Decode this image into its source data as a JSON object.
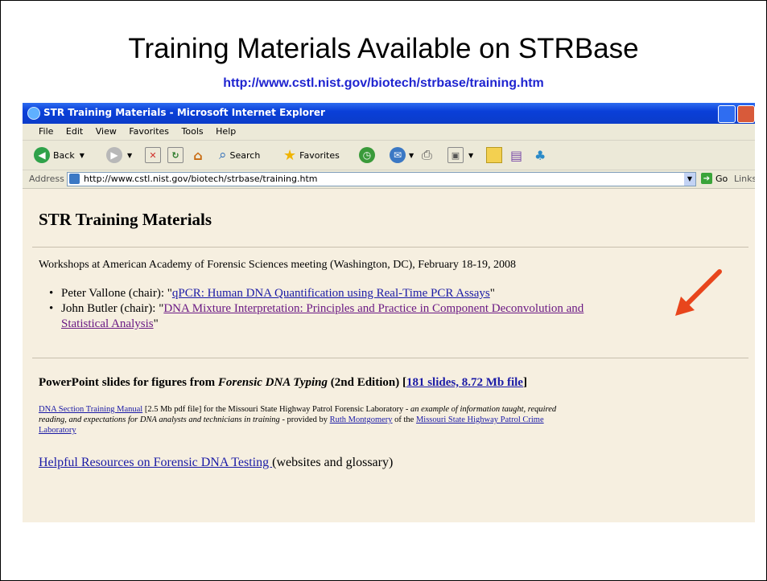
{
  "slide": {
    "title": "Training Materials Available on STRBase",
    "url": "http://www.cstl.nist.gov/biotech/strbase/training.htm"
  },
  "browser": {
    "window_title": "STR Training Materials - Microsoft Internet Explorer",
    "menu": [
      "File",
      "Edit",
      "View",
      "Favorites",
      "Tools",
      "Help"
    ],
    "toolbar": {
      "back": "Back",
      "search": "Search",
      "favorites": "Favorites"
    },
    "address_label": "Address",
    "address_value": "http://www.cstl.nist.gov/biotech/strbase/training.htm",
    "go_label": "Go",
    "links_label": "Links"
  },
  "page": {
    "heading": "STR Training Materials",
    "workshops_text": "Workshops at American Academy of Forensic Sciences meeting (Washington, DC), February 18-19, 2008",
    "item1_prefix": "Peter Vallone (chair): \"",
    "item1_link": "qPCR: Human DNA Quantification using Real-Time PCR Assays",
    "item1_suffix": "\"",
    "item2_prefix": "John Butler (chair): \"",
    "item2_link_line1": "DNA Mixture Interpretation: Principles and Practice in Component Deconvolution and",
    "item2_link_line2": "Statistical Analysis",
    "item2_suffix": "\"",
    "ppt_prefix": "PowerPoint slides for figures from ",
    "ppt_book": "Forensic DNA Typing",
    "ppt_middle": " (2nd Edition) [",
    "ppt_link": "181 slides, 8.72 Mb file",
    "ppt_suffix": "]",
    "manual_link": "DNA Section Training Manual",
    "manual_text1": " [2.5 Mb pdf file] for the Missouri State Highway Patrol Forensic Laboratory - ",
    "manual_italic": "an example of information taught, required",
    "manual_italic2": "reading, and expectations for DNA analysts and technicians in training",
    "manual_text2": " - provided by ",
    "manual_person": "Ruth Montgomery",
    "manual_text3": " of the ",
    "manual_lab_line1": "Missouri State Highway Patrol Crime",
    "manual_lab_line2": "Laboratory",
    "resources_link": "Helpful Resources on Forensic DNA Testing ",
    "resources_text": "(websites and glossary)"
  },
  "colors": {
    "link": "#1a1aa6",
    "visited_link": "#6b1a84",
    "arrow": "#e8451c",
    "url_text": "#1f24d0"
  }
}
